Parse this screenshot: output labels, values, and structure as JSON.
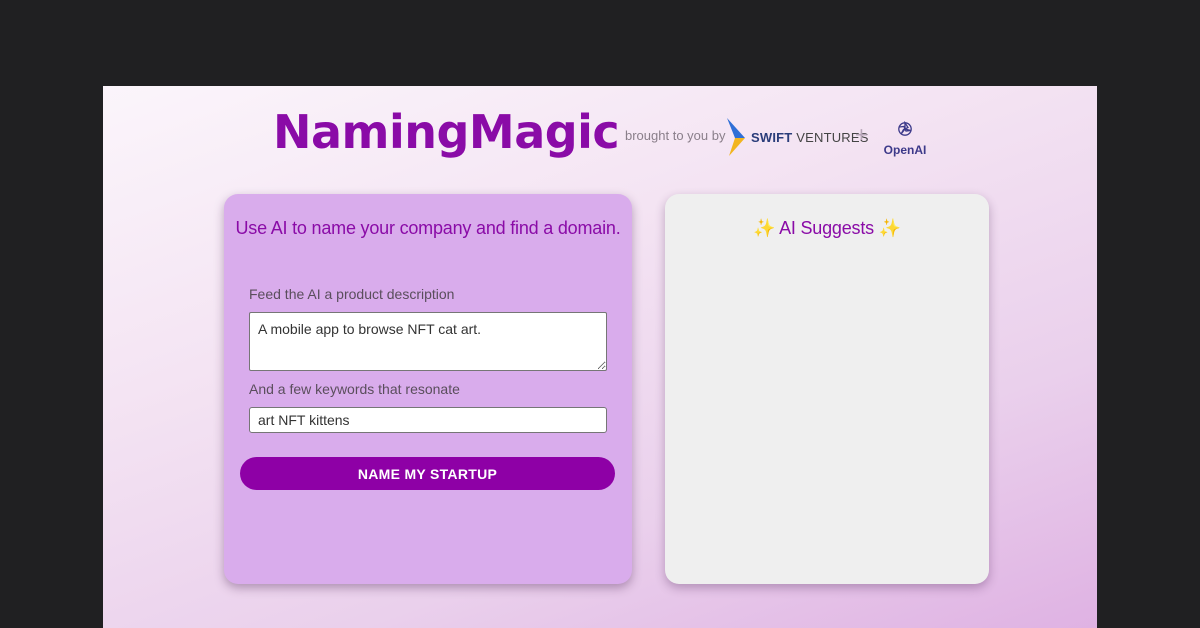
{
  "header": {
    "title": "NamingMagic",
    "brought_by": "brought to you by",
    "sponsor_strong": "SWIFT",
    "sponsor_rest": "VENTURES",
    "plus": "+",
    "partner": "OpenAI"
  },
  "form": {
    "heading": "Use AI to name your company and find a domain.",
    "description_label": "Feed the AI a product description",
    "description_value": "A mobile app to browse NFT cat art.",
    "keywords_label": "And a few keywords that resonate",
    "keywords_value": "art NFT kittens",
    "submit_label": "NAME MY STARTUP"
  },
  "results": {
    "heading": "✨ AI Suggests ✨"
  },
  "colors": {
    "brand": "#8a0ba7",
    "button": "#8e00a6",
    "form_card": "#d9acec",
    "results_card": "#efefef",
    "outer_bg": "#202022"
  },
  "icons": {
    "sponsor_logo": "swift-ventures-chevron-icon",
    "partner_logo": "openai-knot-icon"
  }
}
